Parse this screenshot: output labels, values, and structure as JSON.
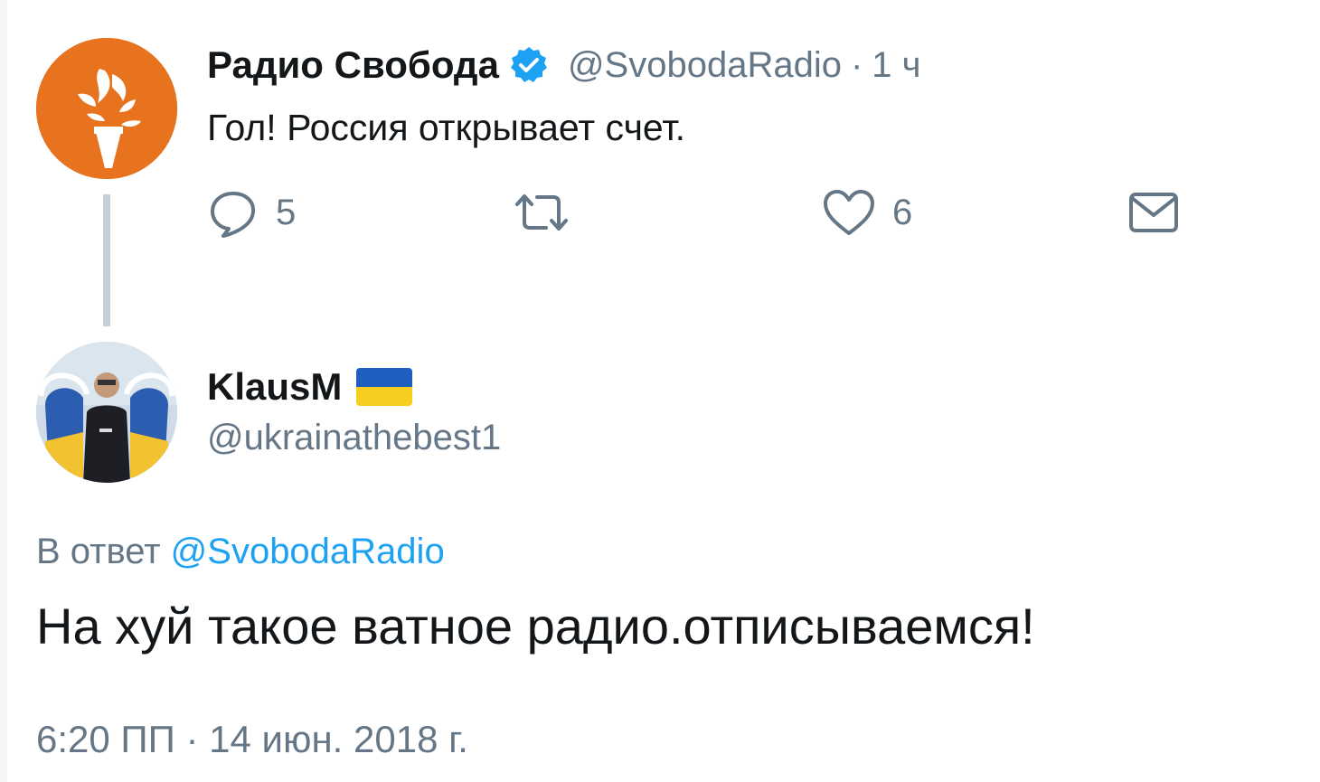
{
  "original_tweet": {
    "display_name": "Радио Свобода",
    "handle": "@SvobodaRadio",
    "separator": "·",
    "time_ago": "1 ч",
    "text": "Гол! Россия открывает счет.",
    "actions": {
      "reply_count": "5",
      "like_count": "6"
    },
    "avatar_icon": "rferl-torch-logo",
    "brand_color": "#e8731e"
  },
  "reply_tweet": {
    "display_name": "KlausM",
    "flag_icon": "ukraine-flag-icon",
    "handle": "@ukrainathebest1",
    "reply_prefix": "В ответ",
    "reply_mention": "@SvobodaRadio",
    "text": "На хуй такое ватное радио.отписываемся!",
    "timestamp": "6:20 ПП · 14 июн. 2018 г."
  },
  "colors": {
    "text_primary": "#14171a",
    "text_secondary": "#657786",
    "link": "#1da1f2",
    "thread_line": "#c4cfd6",
    "verified": "#1da1f2"
  }
}
